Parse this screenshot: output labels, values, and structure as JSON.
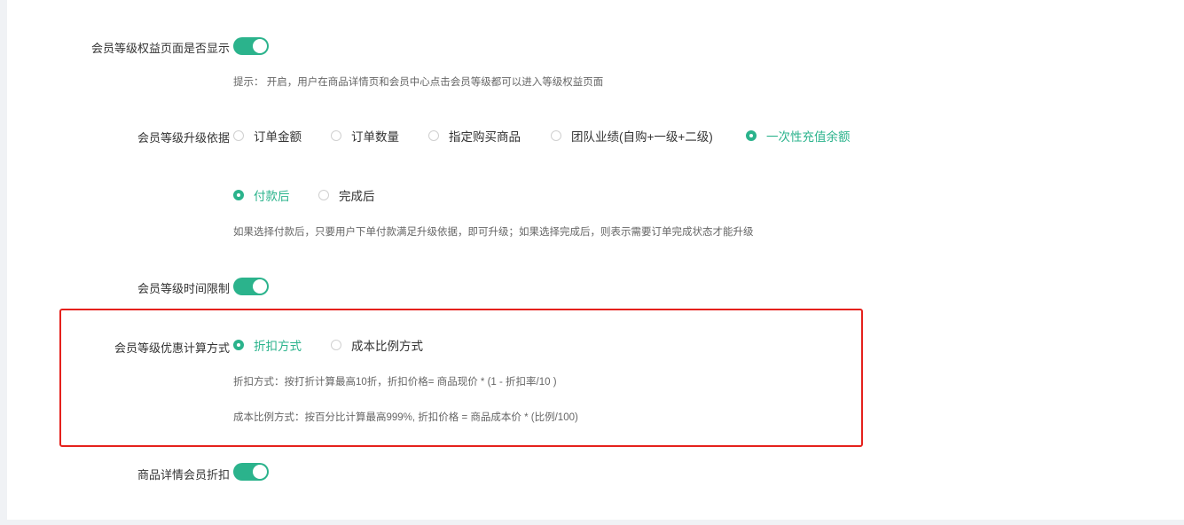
{
  "show_benefit_page": {
    "label": "会员等级权益页面是否显示",
    "enabled": true,
    "hint": "提示： 开启，用户在商品详情页和会员中心点击会员等级都可以进入等级权益页面"
  },
  "upgrade_basis": {
    "label": "会员等级升级依据",
    "options": [
      "订单金额",
      "订单数量",
      "指定购买商品",
      "团队业绩(自购+一级+二级)",
      "一次性充值余额"
    ],
    "selected": "一次性充值余额"
  },
  "upgrade_timing": {
    "options": [
      "付款后",
      "完成后"
    ],
    "selected": "付款后",
    "hint": "如果选择付款后，只要用户下单付款满足升级依据，即可升级；如果选择完成后，则表示需要订单完成状态才能升级"
  },
  "time_limit": {
    "label": "会员等级时间限制",
    "enabled": true
  },
  "discount_method": {
    "label": "会员等级优惠计算方式",
    "options": [
      "折扣方式",
      "成本比例方式"
    ],
    "selected": "折扣方式",
    "hint_discount": "折扣方式：按打折计算最高10折，折扣价格= 商品现价 * (1 - 折扣率/10 )",
    "hint_cost": "成本比例方式：按百分比计算最高999%, 折扣价格 = 商品成本价 * (比例/100)"
  },
  "product_member_discount": {
    "label": "商品详情会员折扣",
    "enabled": true
  },
  "colors": {
    "accent": "#2bb38c",
    "highlight_border": "#e5211c"
  }
}
